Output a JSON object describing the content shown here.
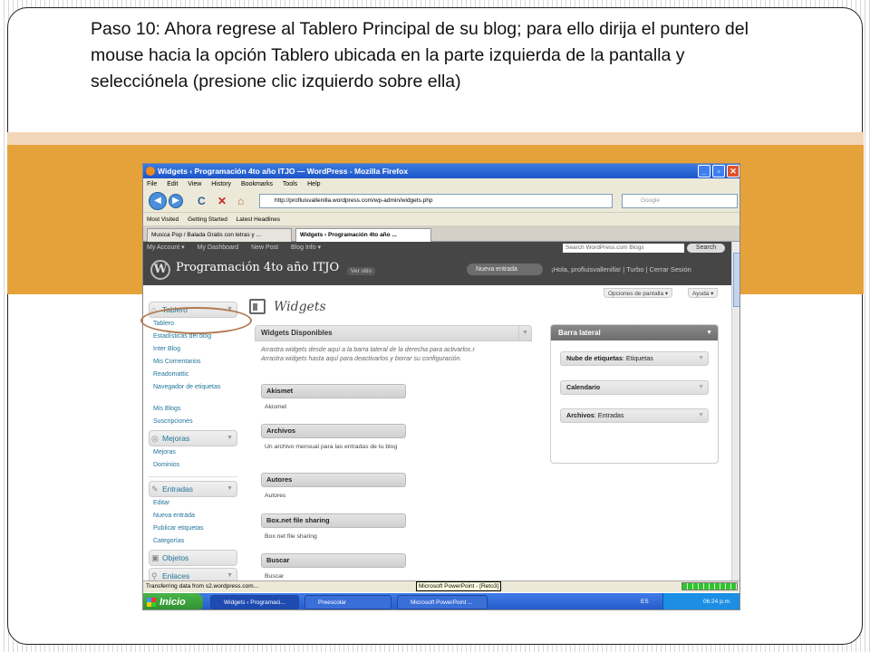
{
  "caption": "Paso 10: Ahora regrese al Tablero Principal de su blog; para ello dirija el puntero del mouse hacia la opción Tablero ubicada en la parte izquierda de la pantalla y selecciónela (presione clic izquierdo sobre ella)",
  "browser": {
    "title": "Widgets ‹ Programación 4to año ITJO — WordPress - Mozilla Firefox",
    "menu": [
      "File",
      "Edit",
      "View",
      "History",
      "Bookmarks",
      "Tools",
      "Help"
    ],
    "url": "http://profluisvallenilla.wordpress.com/wp-admin/widgets.php",
    "search_placeholder": "Google",
    "bookmarks": [
      "Most Visited",
      "Getting Started",
      "Latest Headlines"
    ],
    "tabs": [
      "Musica Pop / Balada Gratis con letras y ...",
      "Widgets ‹ Programación 4to año ..."
    ],
    "status": "Transferring data from s2.wordpress.com...",
    "tooltip": "Microsoft PowerPoint - [Reto3]"
  },
  "wp": {
    "adminbar": [
      "My Account ▾",
      "My Dashboard",
      "New Post",
      "Blog Info ▾"
    ],
    "search_placeholder": "Search WordPress.com Blogs",
    "search_button": "Search",
    "blog_name": "Programación 4to año ITJO",
    "ver_sitio": "Ver sitio",
    "nueva_entrada": "Nueva entrada",
    "hola": "¡Hola, profluisvallenilla! | Turbo | Cerrar Sesión",
    "screen_options": "Opciones de pantalla ▾",
    "help": "Ayuda ▾",
    "page_title": "Widgets",
    "sidebar": {
      "tablero": "Tablero",
      "tablero_items": [
        "Tablero",
        "Estadísticas del blog",
        "Inter Blog",
        "Mis Comentarios",
        "Readomattic",
        "Navegador de etiquetas",
        "Mis Blogs",
        "Suscripciones"
      ],
      "mejoras": "Mejoras",
      "mejoras_items": [
        "Mejoras",
        "Dominios"
      ],
      "entradas": "Entradas",
      "entradas_items": [
        "Editar",
        "Nueva entrada",
        "Publicar etiquetas",
        "Categorías"
      ],
      "objetos": "Objetos",
      "enlaces": "Enlaces"
    },
    "available": {
      "title": "Widgets Disponibles",
      "desc": "Arrastra widgets desde aquí a la barra lateral de la derecha para activarlos.r Arrastra widgets hasta aquí para deactivarlos y borrar su configuración.",
      "widgets": [
        {
          "name": "Akismet",
          "desc": "Akismet"
        },
        {
          "name": "Archivos",
          "desc": "Un archivo mensual para las entradas de tu blog"
        },
        {
          "name": "Autores",
          "desc": "Autores"
        },
        {
          "name": "Box.net file sharing",
          "desc": "Box.net file sharing"
        },
        {
          "name": "Buscar",
          "desc": "Buscar"
        }
      ]
    },
    "sidebar_area": {
      "title": "Barra lateral",
      "items": [
        {
          "name": "Nube de etiquetas",
          "sub": ": Etiquetas"
        },
        {
          "name": "Calendario",
          "sub": ""
        },
        {
          "name": "Archivos",
          "sub": ": Entradas"
        }
      ]
    }
  },
  "taskbar": {
    "start": "Inicio",
    "tasks": [
      "Widgets ‹ Programaci...",
      "Preescolar",
      "Microsoft PowerPoint ..."
    ],
    "lang": "ES",
    "time": "06:24 p.m."
  }
}
